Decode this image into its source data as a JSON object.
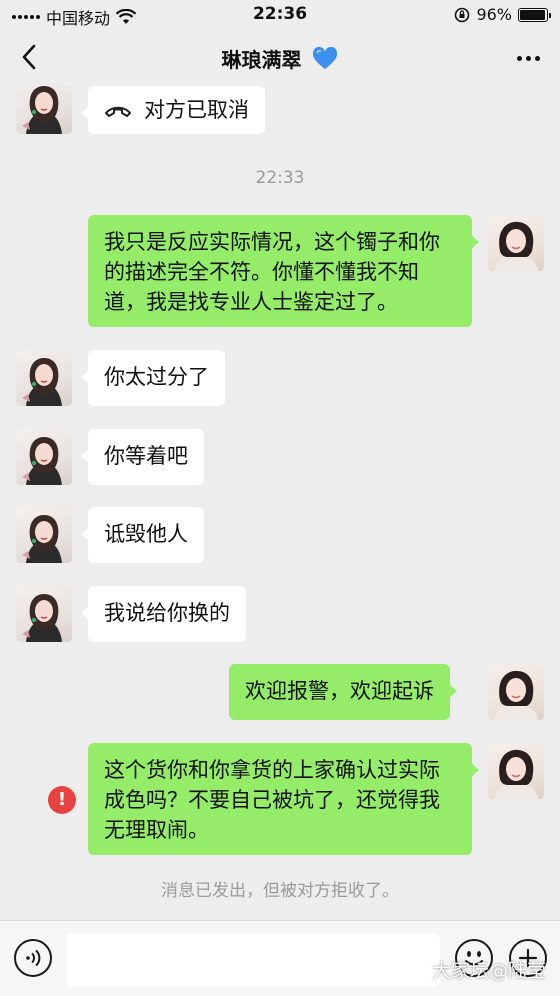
{
  "status_bar": {
    "carrier": "中国移动",
    "time": "22:36",
    "battery_percent": "96%",
    "battery_level": 0.96
  },
  "nav": {
    "title": "琳琅满翠",
    "title_emoji_icon": "blue-heart-icon"
  },
  "chat": {
    "call_status": "对方已取消",
    "timestamp": "22:33",
    "messages": [
      {
        "side": "right",
        "text": "我只是反应实际情况，这个镯子和你的描述完全不符。你懂不懂我不知道，我是找专业人士鉴定过了。"
      },
      {
        "side": "left",
        "text": "你太过分了"
      },
      {
        "side": "left",
        "text": "你等着吧"
      },
      {
        "side": "left",
        "text": "诋毁他人"
      },
      {
        "side": "left",
        "text": "我说给你换的"
      },
      {
        "side": "right",
        "text": "欢迎报警，欢迎起诉"
      },
      {
        "side": "right",
        "text": "这个货你和你拿货的上家确认过实际成色吗？不要自己被坑了，还觉得我无理取闹。",
        "failed": true
      }
    ],
    "failed_icon": "!",
    "system_message": "消息已发出，但被对方拒收了。"
  },
  "input_bar": {
    "value": "",
    "placeholder": ""
  },
  "watermark": "大家坛@陆莹",
  "colors": {
    "background": "#ededed",
    "bubble_self": "#95ec69",
    "bubble_other": "#ffffff",
    "error": "#e64340"
  }
}
